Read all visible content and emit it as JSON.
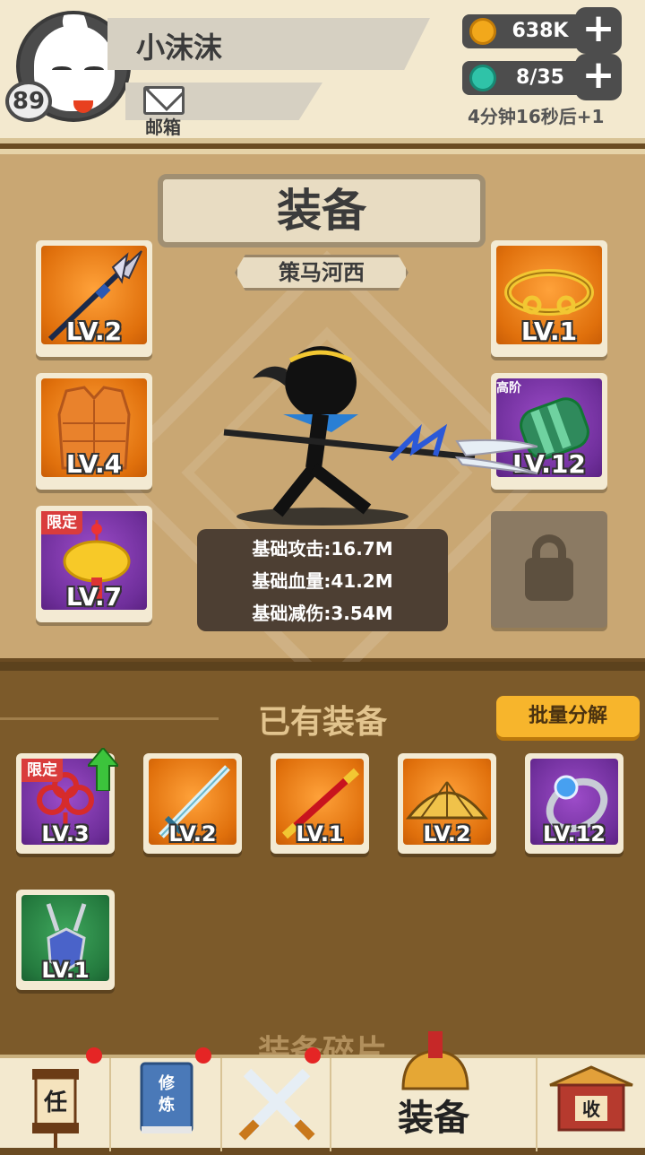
{
  "player": {
    "name": "小沫沫",
    "level": "89",
    "mail_label": "邮箱"
  },
  "resources": {
    "coins": "638K",
    "energy": "8/35",
    "refill_timer": "4分钟16秒后+1"
  },
  "equip_panel": {
    "title": "装备",
    "subtitle": "策马河西",
    "slots": [
      {
        "level": "LV.2",
        "item": "halberd"
      },
      {
        "level": "LV.4",
        "item": "armor-vest"
      },
      {
        "level": "LV.7",
        "item": "golden-pendant",
        "tag": "限定"
      },
      {
        "level": "LV.1",
        "item": "golden-headband"
      },
      {
        "level": "LV.12",
        "item": "bracer",
        "tag": "高阶"
      }
    ],
    "stats": [
      "基础攻击:16.7M",
      "基础血量:41.2M",
      "基础减伤:3.54M"
    ]
  },
  "inventory": {
    "title": "已有装备",
    "bulk_button": "批量分解",
    "items": [
      {
        "level": "LV.3",
        "item": "red-knot",
        "tag": "限定",
        "color": "purple"
      },
      {
        "level": "LV.2",
        "item": "sword",
        "color": "orange"
      },
      {
        "level": "LV.1",
        "item": "staff",
        "color": "orange"
      },
      {
        "level": "LV.2",
        "item": "straw-hat",
        "color": "orange"
      },
      {
        "level": "LV.12",
        "item": "ring",
        "color": "purple"
      },
      {
        "level": "LV.1",
        "item": "amulet",
        "color": "green"
      }
    ],
    "fragments_title": "装备碎片"
  },
  "nav": {
    "tasks_icon_label": "任",
    "training_icon_label": "修炼",
    "equip_label": "装备",
    "collect_icon_label": "收"
  },
  "colors": {
    "orange": "#e0700c",
    "purple": "#6f2f9b",
    "green": "#247a3e",
    "accent": "#f7b52c"
  }
}
